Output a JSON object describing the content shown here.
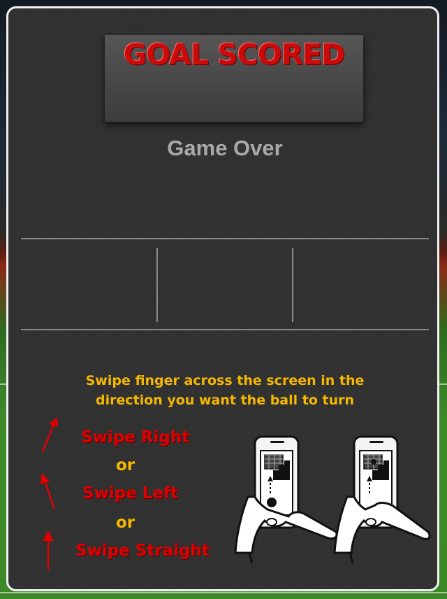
{
  "result_banner": "GOAL SCORED",
  "status": "Game Over",
  "instructions": {
    "line1": "Swipe finger across the screen in the",
    "line2": "direction you want the ball to turn"
  },
  "swipes": {
    "right": "Swipe Right",
    "or1": "or",
    "left": "Swipe Left",
    "or2": "or",
    "straight": "Swipe Straight"
  },
  "colors": {
    "banner_text": "#cc0a0a",
    "status_text": "#a9a9a9",
    "instruction_text": "#f5b800",
    "swipe_text": "#dd0000",
    "card_bg": "#2f2f2f",
    "card_border": "#f2f2f2"
  },
  "icons": {
    "arrow_right": "arrow-up-right-icon",
    "arrow_left": "arrow-up-left-icon",
    "arrow_straight": "arrow-up-icon",
    "phones": "phone-swipe-illustration"
  }
}
